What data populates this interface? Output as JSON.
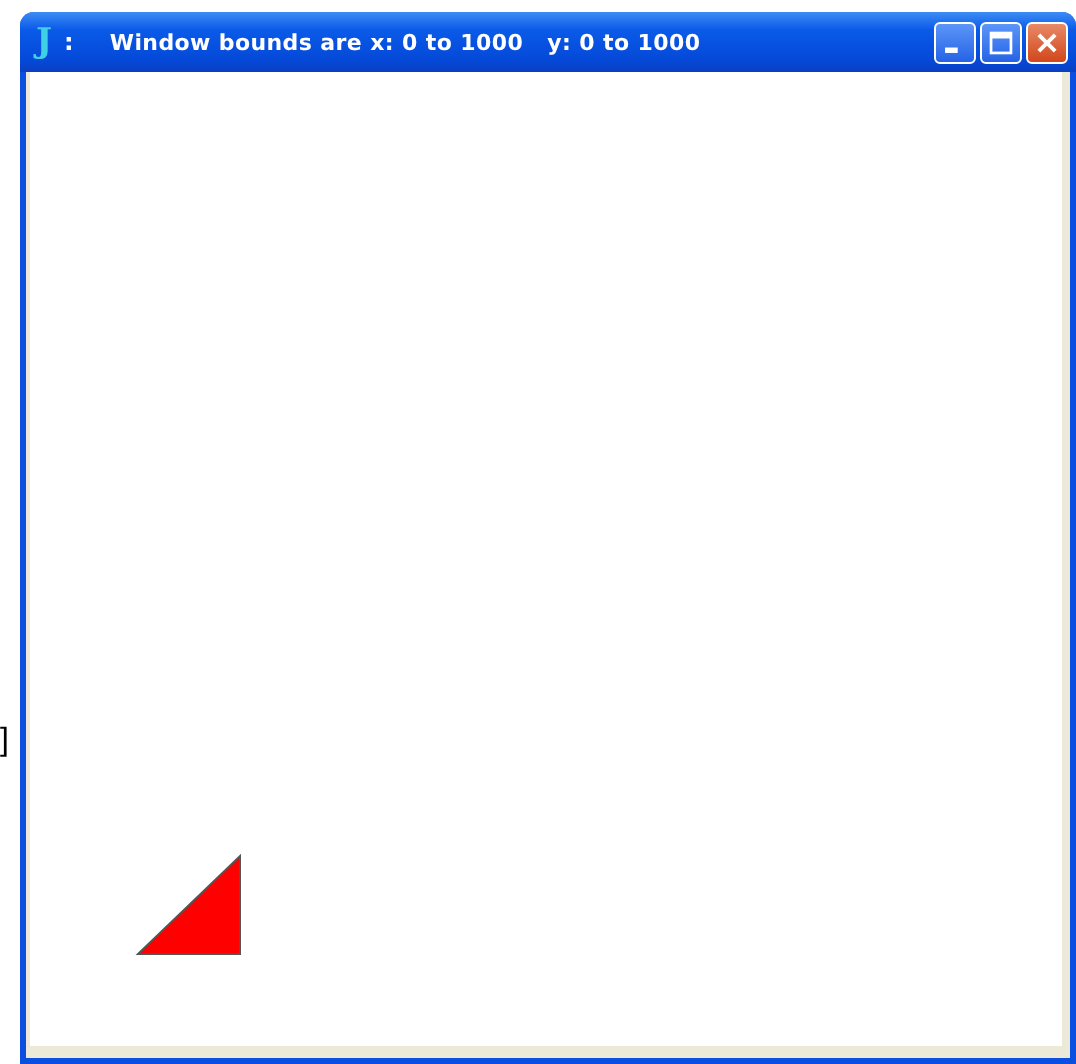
{
  "background_text": "]",
  "window": {
    "app_letter": "J",
    "separator": ":",
    "title": "Window bounds are x: 0 to 1000   y: 0 to 1000"
  },
  "canvas": {
    "shapes": [
      {
        "kind": "triangle"
      }
    ]
  }
}
